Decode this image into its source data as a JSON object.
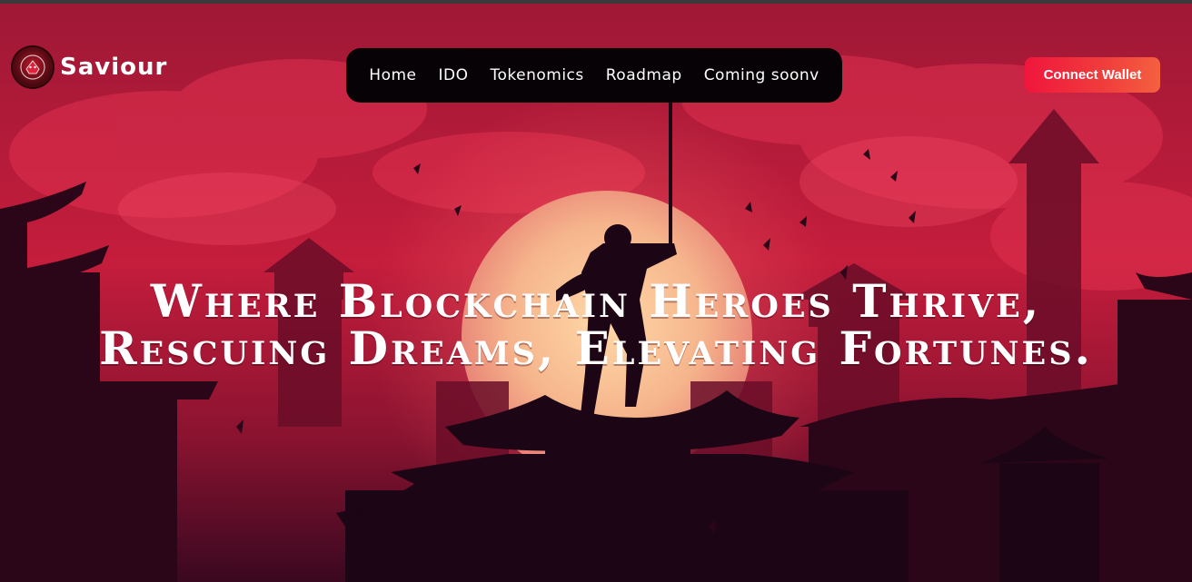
{
  "brand": {
    "name": "Saviour"
  },
  "nav": {
    "items": [
      {
        "label": "Home"
      },
      {
        "label": "IDO"
      },
      {
        "label": "Tokenomics"
      },
      {
        "label": "Roadmap"
      },
      {
        "label": "Coming soonv"
      }
    ]
  },
  "header": {
    "connect_label": "Connect Wallet"
  },
  "hero": {
    "line1": "Where Blockchain Heroes Thrive,",
    "line2": "Rescuing Dreams, Elevating Fortunes."
  },
  "colors": {
    "sky": "#c51d3c",
    "sun": "#f6b58c",
    "silhouette": "#1c0514",
    "button": "#f0163c",
    "nav_bg": "#070205"
  },
  "icons": {
    "logo": "samurai-emblem-icon"
  }
}
